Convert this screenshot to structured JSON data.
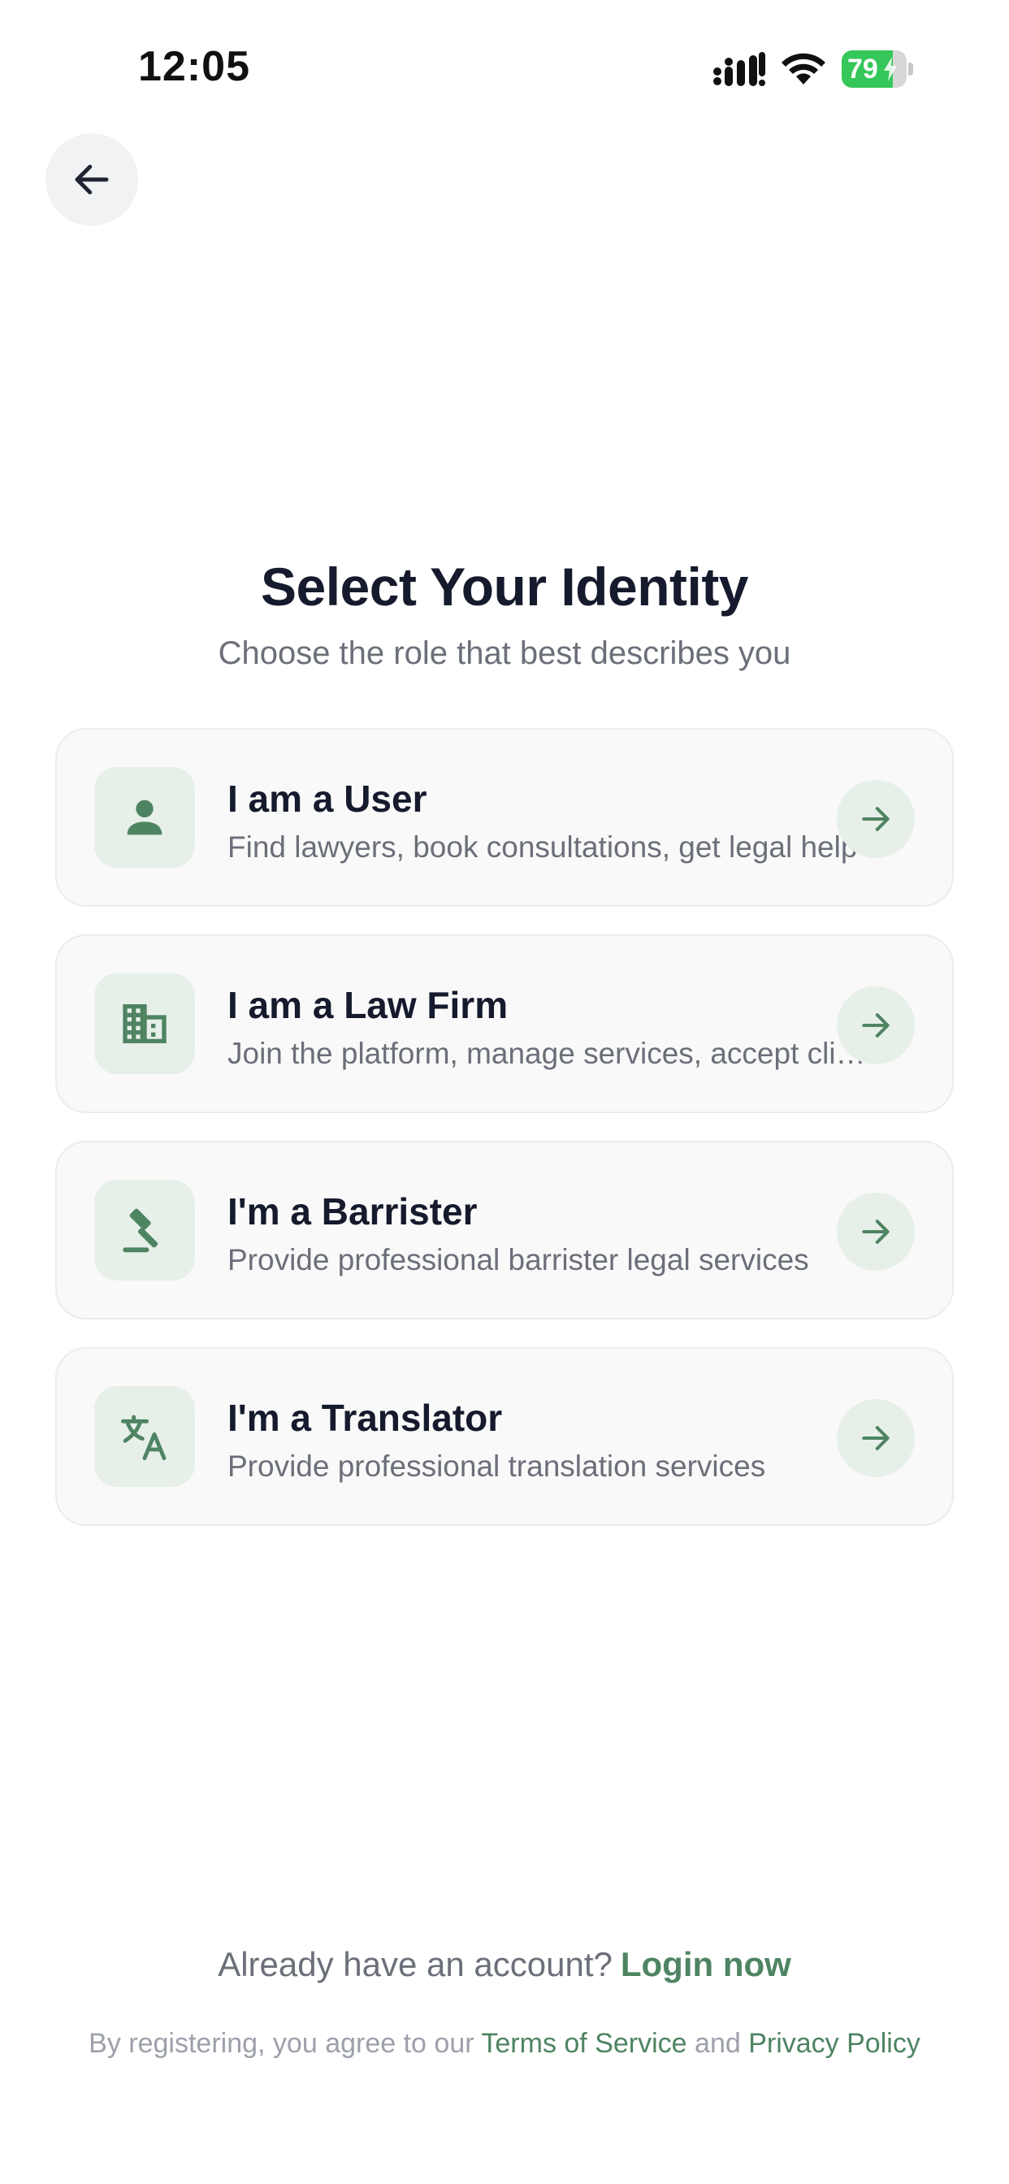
{
  "status_bar": {
    "time": "12:05",
    "battery_level": "79",
    "battery_fraction": 0.79,
    "battery_color": "#35c759"
  },
  "header": {
    "back_icon": "arrow-left-icon"
  },
  "main": {
    "title": "Select Your Identity",
    "subtitle": "Choose the role that best describes you",
    "accent_color": "#4e8462",
    "roles": [
      {
        "icon": "person-icon",
        "title": "I am a User",
        "description": "Find lawyers, book consultations, get legal help"
      },
      {
        "icon": "building-icon",
        "title": "I am a Law Firm",
        "description": "Join the platform, manage services, accept clients"
      },
      {
        "icon": "gavel-icon",
        "title": "I'm a Barrister",
        "description": "Provide professional barrister legal services"
      },
      {
        "icon": "translate-icon",
        "title": "I'm a Translator",
        "description": "Provide professional translation services"
      }
    ],
    "arrow_icon": "arrow-right-icon"
  },
  "footer": {
    "login_prompt": "Already have an account?",
    "login_link": "Login now",
    "terms_prefix": "By registering, you agree to our",
    "terms_link": "Terms of Service",
    "terms_and": "and",
    "privacy_link": "Privacy Policy"
  }
}
